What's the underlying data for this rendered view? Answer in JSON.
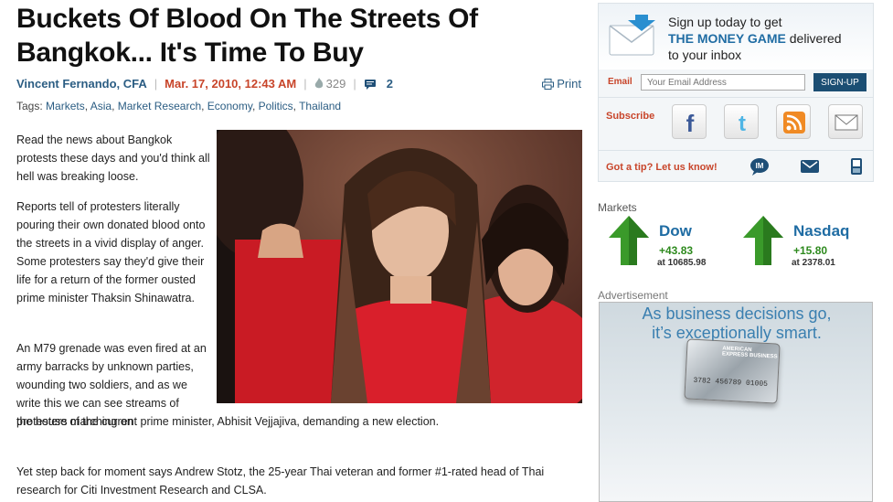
{
  "article": {
    "headline": "Buckets Of Blood On The Streets Of Bangkok... It's Time To Buy",
    "author": "Vincent Fernando, CFA",
    "date": "Mar. 17, 2010, 12:43 AM",
    "views": "329",
    "comments": "2",
    "print_label": "Print",
    "tags_label": "Tags:",
    "tags": [
      "Markets",
      "Asia",
      "Market Research",
      "Economy",
      "Politics",
      "Thailand"
    ],
    "paragraphs": [
      "Read the news about Bangkok protests these days and you'd think all hell was breaking loose.",
      "Reports tell of protesters literally pouring their own donated blood onto the streets in a vivid display of anger. Some protesters say they'd give their life for a return of the former ousted prime minister Thaksin Shinawatra.",
      "An M79 grenade was even fired at an army barracks by unknown parties, wounding two soldiers, and as we write this we can see streams of protesters marching on",
      "the house of the current prime minister, Abhisit Vejjajiva, demanding a new election.",
      "Yet step back for moment says Andrew Stotz, the 25-year Thai veteran and former #1-rated head of Thai research for Citi Investment Research and CLSA."
    ]
  },
  "sidebar": {
    "signup": {
      "line1": "Sign up today to get",
      "brand": "THE MONEY GAME",
      "line2": " delivered",
      "line3": "to your inbox",
      "email_label": "Email",
      "email_placeholder": "Your Email Address",
      "button": "SIGN-UP"
    },
    "subscribe_label": "Subscribe",
    "social_icons": [
      "facebook-icon",
      "twitter-icon",
      "rss-icon",
      "email-icon"
    ],
    "tip_label": "Got a tip? Let us know!",
    "tip_im": "IM",
    "markets": {
      "label": "Markets",
      "items": [
        {
          "name": "Dow",
          "change": "+43.83",
          "at": "at 10685.98"
        },
        {
          "name": "Nasdaq",
          "change": "+15.80",
          "at": "at 2378.01"
        }
      ]
    },
    "ad": {
      "label": "Advertisement",
      "line1": "As business decisions go,",
      "line2": "it’s exceptionally smart.",
      "card_number": "3782 456789 01005",
      "card_brand": "AMERICAN EXPRESS BUSINESS"
    }
  },
  "colors": {
    "link_blue": "#2b5d83",
    "date_red": "#c8452a",
    "gain_green": "#2e8a1e"
  }
}
